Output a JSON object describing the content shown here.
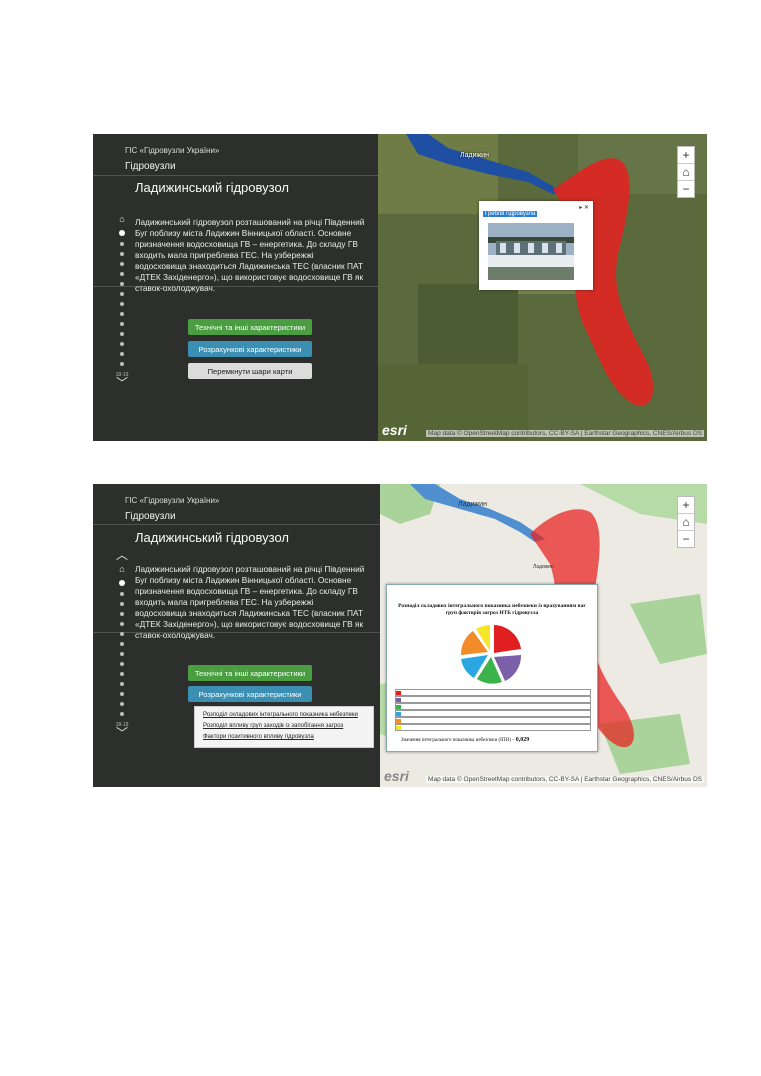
{
  "app_title": "ГІС «Гідровузли України»",
  "series_title": "Гідровузли",
  "story": {
    "title": "Ладижинський гідровузол",
    "body": "Ладижинський гідровузол розташований на річці Південний Буг поблизу міста Ладижин Вінницької області. Основне призначення водосховища ГВ – енергетика. До складу ГВ входить мала пригреблева ГЕС. На узбережжі водосховища знаходиться Ладижинська ТЕС (власник ПАТ «ДТЕК Західенерго»), що використовує водосховище ГВ як ставок-охолоджувач."
  },
  "nav": {
    "count": "18-19"
  },
  "buttons": {
    "tech": "Технічні та інші характеристики",
    "calc": "Розрахункові характеристики",
    "switch": "Перемкнути шари карти"
  },
  "dropdown": [
    "Розподіл складових інтегрального показника небезпеки",
    "Розподіл впливу груп заходів із запобігання загроз",
    "Фактори позитивного впливу гідровузла"
  ],
  "map": {
    "town_label": "Ладижин",
    "area_label": "Ладижин",
    "attribution": "Map data © OpenStreetMap contributors, CC-BY-SA | Earthstar Geographics, CNES/Airbus DS",
    "esri": "esri",
    "popup_title": "Гребля гідровузла",
    "popup_controls": "▸ ✕"
  },
  "zoom": {
    "in": "+",
    "home": "⌂",
    "out": "−"
  },
  "dialog": {
    "title": "Розподіл складових інтегрального показника небезпеки із врахуванням ваг груп факторів загроз НТБ гідровузла",
    "index_label": "Значення інтегрального показника небезпеки (ІПН) –",
    "index_value": "0,029",
    "legend_colors": [
      "#e02020",
      "#7b5fa8",
      "#3bb34a",
      "#2aa7e0",
      "#f28c28",
      "#f7e52a"
    ]
  },
  "colors": {
    "flood": "#e8201e",
    "reservoir": "#1f4fa3",
    "btn_green": "#4a9d40",
    "btn_blue": "#3b8fb3"
  }
}
